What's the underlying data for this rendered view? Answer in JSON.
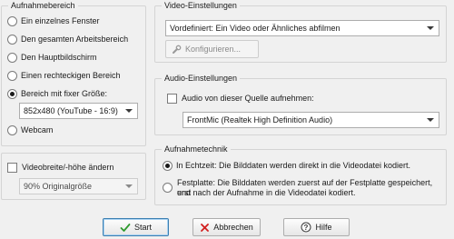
{
  "aufnahmebereich": {
    "title": "Aufnahmebereich",
    "options": [
      {
        "label": "Ein einzelnes Fenster",
        "checked": false
      },
      {
        "label": "Den gesamten Arbeitsbereich",
        "checked": false
      },
      {
        "label": "Den Hauptbildschirm",
        "checked": false
      },
      {
        "label": "Einen rechteckigen Bereich",
        "checked": false
      },
      {
        "label": "Bereich mit fixer Größe:",
        "checked": true
      },
      {
        "label": "Webcam",
        "checked": false
      }
    ],
    "fixed_size_select": "852x480 (YouTube - 16:9)"
  },
  "video": {
    "title": "Video-Einstellungen",
    "preset_select": "Vordefiniert: Ein Video oder Ähnliches abfilmen",
    "configure_button": "Konfigurieren..."
  },
  "audio": {
    "title": "Audio-Einstellungen",
    "record_checkbox_label": "Audio von dieser Quelle aufnehmen:",
    "record_checked": false,
    "source_select": "FrontMic (Realtek High Definition Audio)"
  },
  "resize": {
    "checkbox_label": "Videobreite/-höhe ändern",
    "checked": false,
    "size_select": "90% Originalgröße"
  },
  "technik": {
    "title": "Aufnahmetechnik",
    "option1": "In Echtzeit: Die Bilddaten werden direkt in die Videodatei kodiert.",
    "option1_checked": true,
    "option2_line1": "Festplatte: Die Bilddaten werden zuerst auf der Festplatte gespeichert, und",
    "option2_line2": "erst nach der Aufnahme in die Videodatei kodiert.",
    "option2_checked": false
  },
  "buttons": {
    "start": "Start",
    "cancel": "Abbrechen",
    "help": "Hilfe"
  },
  "colors": {
    "start_check": "#2e9a2e",
    "cancel_x": "#d21f1f"
  }
}
